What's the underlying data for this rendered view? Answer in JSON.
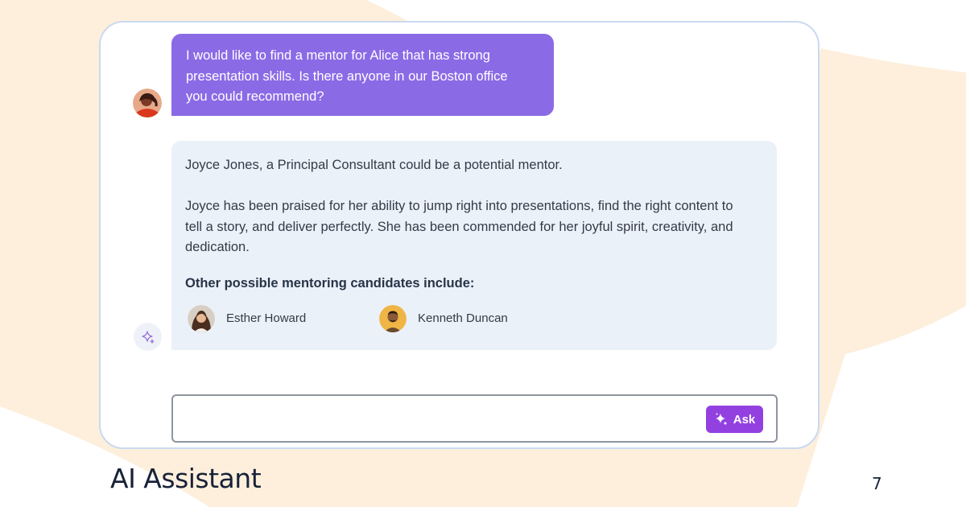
{
  "user_message": {
    "line1": "I would like to find a mentor for Alice that has strong",
    "line2": "presentation skills. Is there anyone in our Boston office",
    "line3": "you could recommend?"
  },
  "assistant_message": {
    "paragraph1": "Joyce Jones, a Principal Consultant could be a potential mentor.",
    "paragraph2_line1": "Joyce has been praised for her ability to jump right into presentations, find the right content to",
    "paragraph2_line2": "tell a story, and deliver perfectly. She has been commended for her joyful spirit, creativity, and",
    "paragraph2_line3": "dedication.",
    "candidates_heading": "Other possible mentoring candidates include:",
    "candidates": [
      {
        "name": "Esther Howard"
      },
      {
        "name": "Kenneth Duncan"
      }
    ]
  },
  "input": {
    "value": "",
    "placeholder": ""
  },
  "ask_button": {
    "label": "Ask"
  },
  "footer": {
    "title": "AI Assistant",
    "page_number": "7"
  },
  "icons": {
    "assistant_avatar": "sparkle-icon",
    "ask_button_icon": "sparkle-icon"
  },
  "colors": {
    "user_bubble": "#8b6ae6",
    "assistant_bubble": "#ebf1f9",
    "ask_button": "#9340e0",
    "background_shape": "#fdefdc"
  }
}
